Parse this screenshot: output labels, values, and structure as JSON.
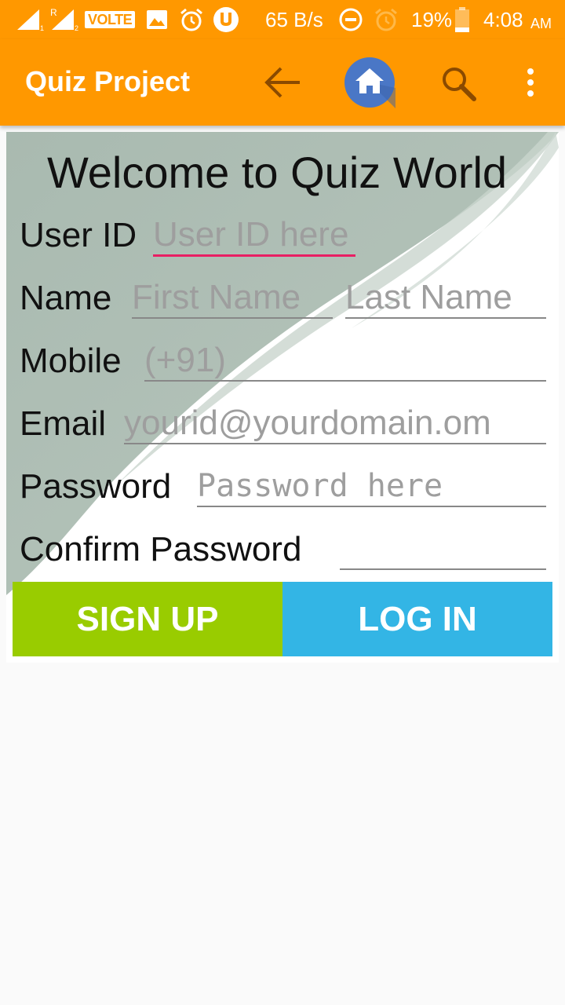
{
  "status_bar": {
    "volte": "VOLTE",
    "speed": "65 B/s",
    "battery": "19%",
    "time": "4:08",
    "ampm": "AM"
  },
  "app_bar": {
    "title": "Quiz Project",
    "icons": [
      "back-arrow-icon",
      "home-icon",
      "search-icon",
      "overflow-menu-icon"
    ]
  },
  "form": {
    "welcome": "Welcome to Quiz World",
    "user_id": {
      "label": "User ID",
      "placeholder": "User ID here"
    },
    "name": {
      "label": "Name",
      "first_placeholder": "First Name",
      "last_placeholder": "Last Name"
    },
    "mobile": {
      "label": "Mobile",
      "placeholder": "(+91)"
    },
    "email": {
      "label": "Email",
      "placeholder": "yourid@yourdomain.om"
    },
    "password": {
      "label": "Password",
      "placeholder": "Password here"
    },
    "confirm_password": {
      "label": "Confirm Password",
      "placeholder": ""
    }
  },
  "buttons": {
    "signup": "SIGN UP",
    "login": "LOG IN"
  },
  "colors": {
    "appbar": "#ff9800",
    "signup": "#99cc00",
    "login": "#33b5e5",
    "focus_underline": "#e91e63",
    "home_circle": "#4a77c6"
  }
}
